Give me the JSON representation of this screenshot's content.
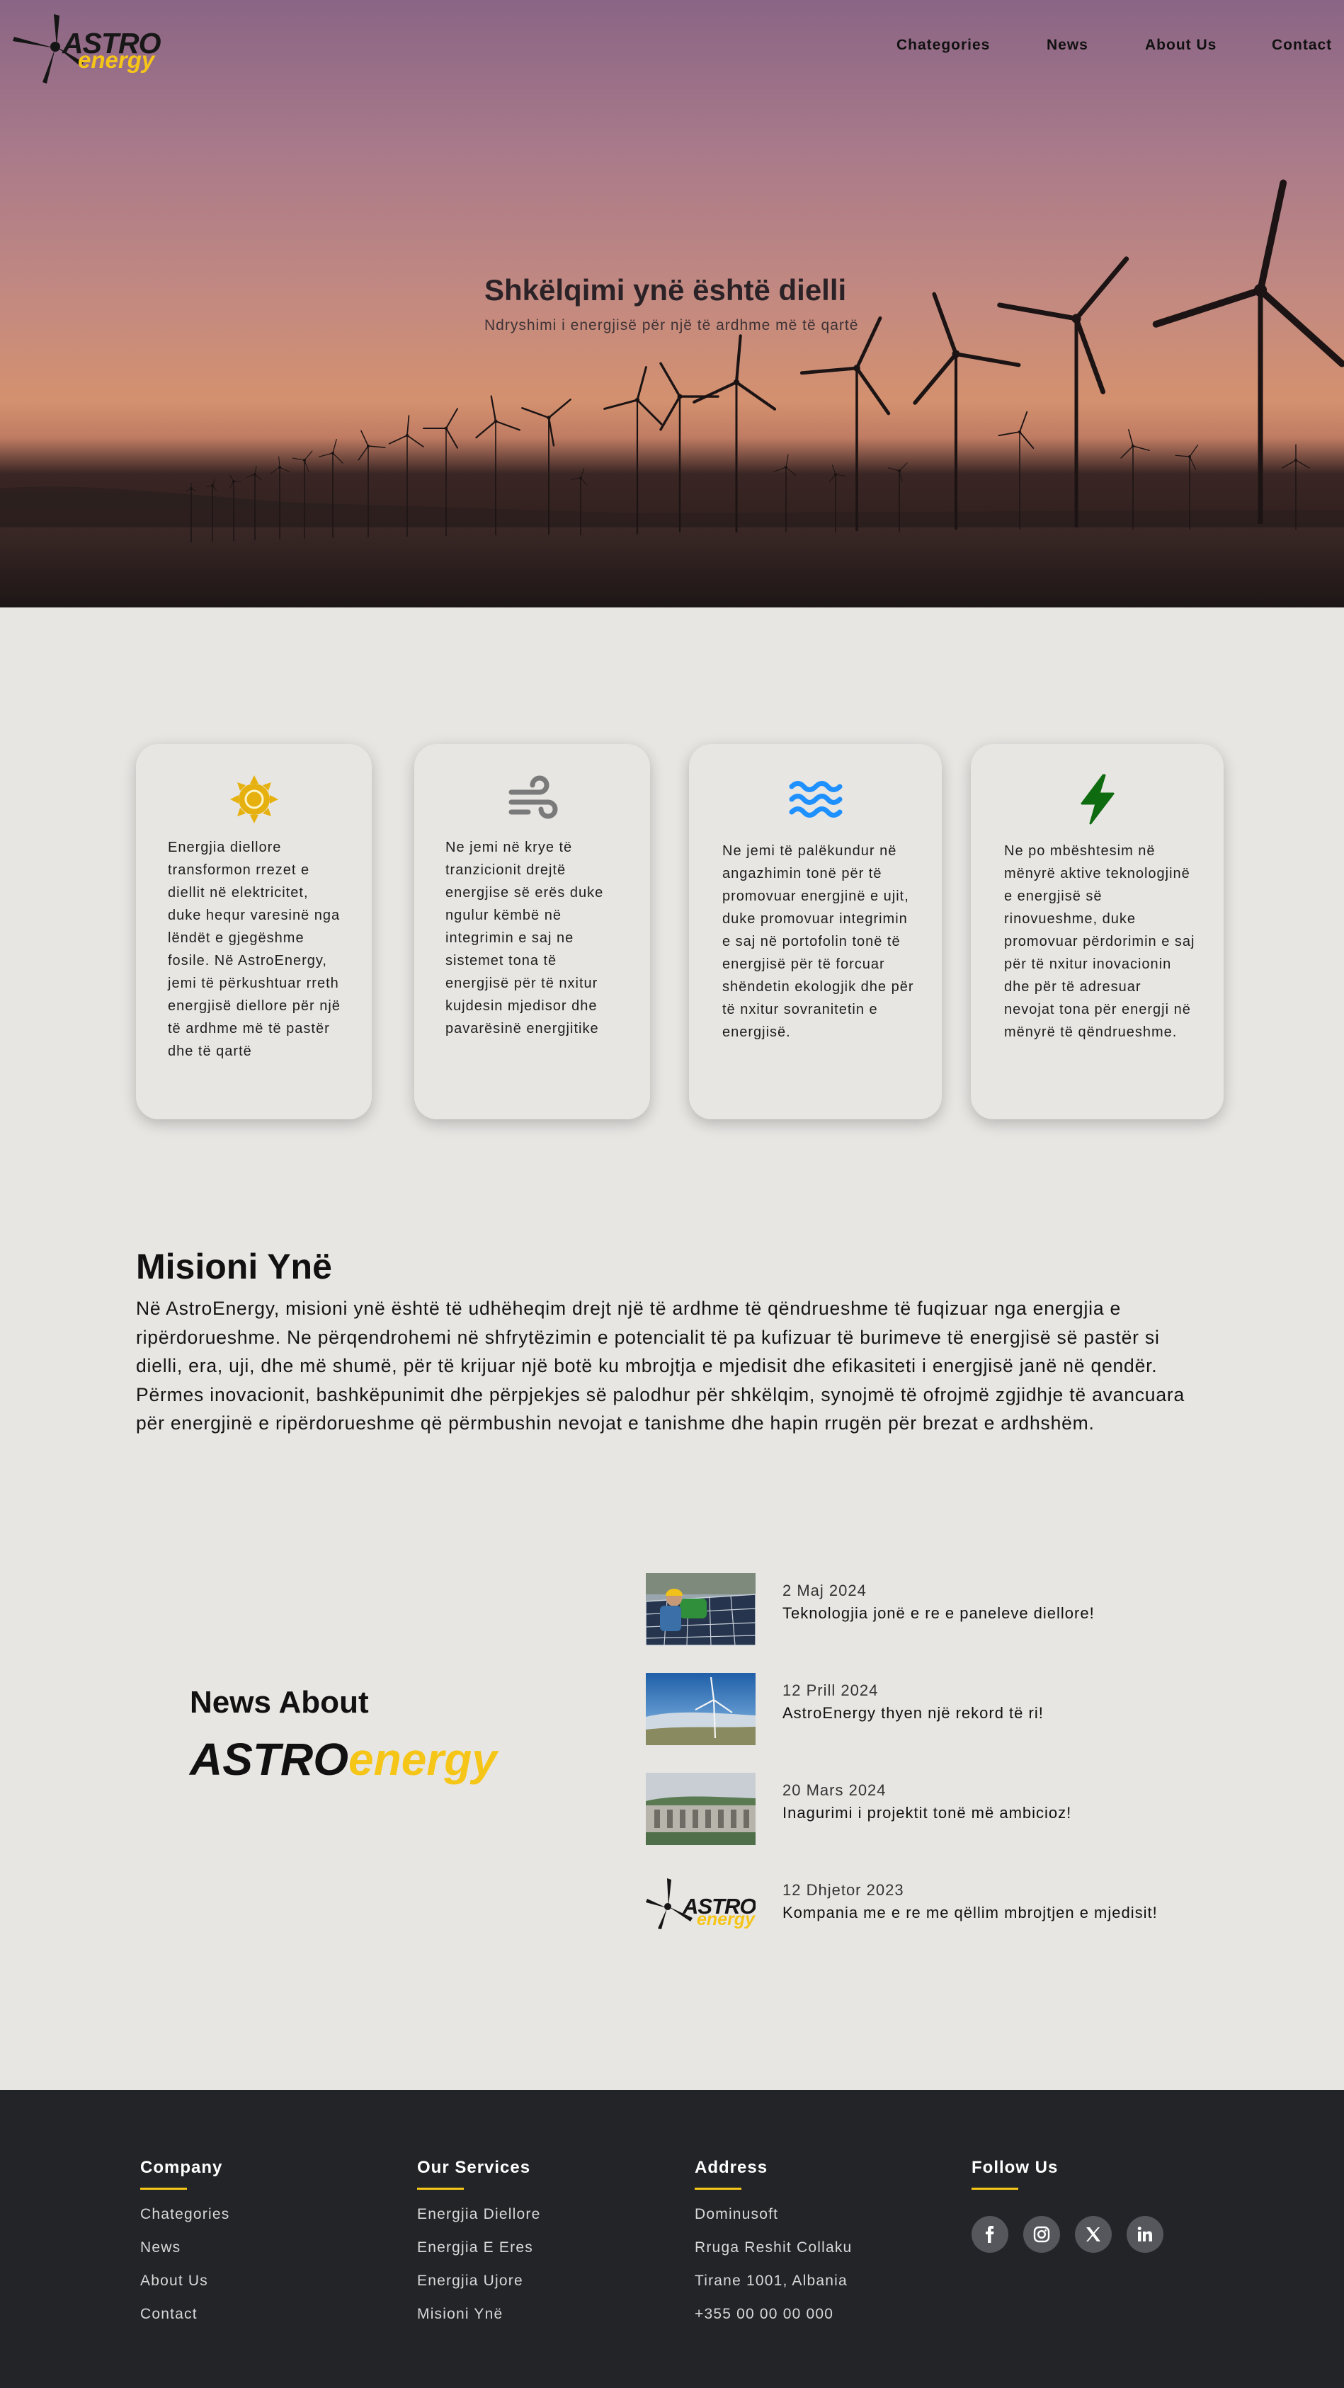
{
  "header": {
    "logo": {
      "word1": "ASTRO",
      "word2": "energy"
    },
    "nav": [
      "Chategories",
      "News",
      "About Us",
      "Contact"
    ]
  },
  "hero": {
    "title": "Shkëlqimi ynë është dielli",
    "subtitle": "Ndryshimi i energjisë për një të ardhme më të qartë"
  },
  "features": [
    {
      "icon": "sun-icon",
      "color": "#e6b10f",
      "text": "Energjia diellore transformon rrezet e diellit në elektricitet, duke hequr varesinë nga lëndët e gjegëshme fosile. Në AstroEnergy, jemi të përkushtuar rreth energjisë diellore për një të ardhme më të pastër dhe të qartë"
    },
    {
      "icon": "wind-icon",
      "color": "#7a7a7a",
      "text": "Ne jemi në krye të tranzicionit drejtë energjise së erës duke ngulur këmbë në integrimin e saj ne sistemet tona të energjisë për të nxitur kujdesin mjedisor dhe pavarësinë energjitike"
    },
    {
      "icon": "water-icon",
      "color": "#1e90ff",
      "text": "Ne jemi të palëkundur në angazhimin tonë për të promovuar energjinë e ujit, duke promovuar integrimin e saj në portofolin tonë të energjisë për të forcuar shëndetin ekologjik dhe për të nxitur sovranitetin e energjisë."
    },
    {
      "icon": "lightning-icon",
      "color": "#0f6b0f",
      "text": "Ne po mbështesim në mënyrë aktive teknologjinë e energjisë së rinovueshme, duke promovuar përdorimin e saj për të nxitur inovacionin dhe për të adresuar nevojat tona për energji në mënyrë të qëndrueshme."
    }
  ],
  "mission": {
    "title": "Misioni Ynë",
    "text": "Në AstroEnergy, misioni ynë është të udhëheqim drejt një të ardhme të qëndrueshme të fuqizuar nga energjia e ripërdorueshme. Ne përqendrohemi në shfrytëzimin e potencialit të pa kufizuar të burimeve të energjisë së pastër si dielli, era, uji, dhe më shumë, për të krijuar një botë ku mbrojtja e mjedisit dhe efikasiteti i energjisë janë në qendër. Përmes inovacionit, bashkëpunimit dhe përpjekjes së palodhur për shkëlqim, synojmë të ofrojmë zgjidhje të avancuara për energjinë e ripërdorueshme që përmbushin nevojat e tanishme dhe hapin rrugën për brezat e ardhshëm."
  },
  "news": {
    "heading": "News About",
    "brand_a": "ASTRO",
    "brand_b": "energy",
    "items": [
      {
        "date": "2 Maj 2024",
        "headline": "Teknologjia jonë e re e paneleve diellore!"
      },
      {
        "date": "12 Prill 2024",
        "headline": "AstroEnergy thyen një rekord të ri!"
      },
      {
        "date": "20 Mars 2024",
        "headline": "Inagurimi i projektit tonë më ambicioz!"
      },
      {
        "date": "12 Dhjetor 2023",
        "headline": "Kompania me e re me qëllim mbrojtjen e mjedisit!"
      }
    ],
    "thumb_logo": {
      "word1": "ASTRO",
      "word2": "energy"
    }
  },
  "footer": {
    "company": {
      "title": "Company",
      "links": [
        "Chategories",
        "News",
        "About Us",
        "Contact"
      ]
    },
    "services": {
      "title": "Our Services",
      "links": [
        "Energjia Diellore",
        "Energjia E Eres",
        "Energjia Ujore",
        "Misioni Ynë"
      ]
    },
    "address": {
      "title": "Address",
      "lines": [
        "Dominusoft",
        "Rruga Reshit Collaku",
        "Tirane 1001, Albania",
        "+355 00 00 00 000"
      ]
    },
    "follow": {
      "title": "Follow Us",
      "icons": [
        "facebook-icon",
        "instagram-icon",
        "x-icon",
        "linkedin-icon"
      ]
    }
  },
  "colors": {
    "accent": "#f5c518",
    "footer_bg": "#232428",
    "page_bg": "#e8e6e3"
  }
}
